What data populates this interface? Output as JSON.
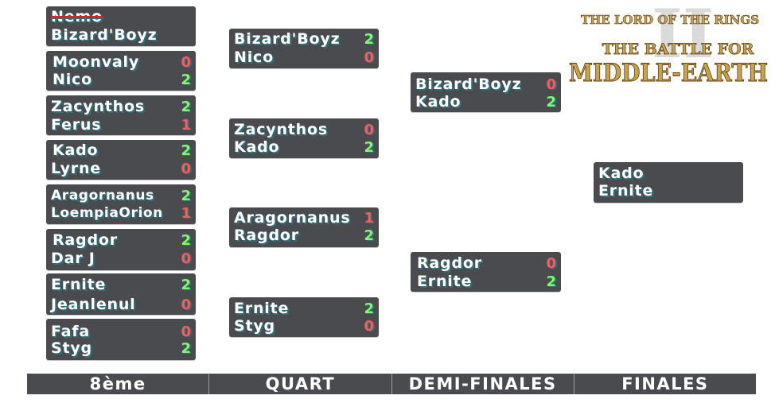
{
  "rounds": {
    "r16": [
      {
        "p1": {
          "name": "Nemo",
          "score": ""
        },
        "p2": {
          "name": "Bizard'Boyz",
          "score": ""
        }
      },
      {
        "p1": {
          "name": "Moonvaly",
          "score": "0"
        },
        "p2": {
          "name": "Nico",
          "score": "2"
        }
      },
      {
        "p1": {
          "name": "Zacynthos",
          "score": "2"
        },
        "p2": {
          "name": "Ferus",
          "score": "1"
        }
      },
      {
        "p1": {
          "name": "Kado",
          "score": "2"
        },
        "p2": {
          "name": "Lyrne",
          "score": "0"
        }
      },
      {
        "p1": {
          "name": "Aragornanus",
          "score": "2"
        },
        "p2": {
          "name": "LoempiaOrion",
          "score": "1"
        }
      },
      {
        "p1": {
          "name": "Ragdor",
          "score": "2"
        },
        "p2": {
          "name": "Dar J",
          "score": "0"
        }
      },
      {
        "p1": {
          "name": "Ernite",
          "score": "2"
        },
        "p2": {
          "name": "Jeanlenul",
          "score": "0"
        }
      },
      {
        "p1": {
          "name": "Fafa",
          "score": "0"
        },
        "p2": {
          "name": "Styg",
          "score": "2"
        }
      }
    ],
    "qf": [
      {
        "p1": {
          "name": "Bizard'Boyz",
          "score": "2"
        },
        "p2": {
          "name": "Nico",
          "score": "0"
        }
      },
      {
        "p1": {
          "name": "Zacynthos",
          "score": "0"
        },
        "p2": {
          "name": "Kado",
          "score": "2"
        }
      },
      {
        "p1": {
          "name": "Aragornanus",
          "score": "1"
        },
        "p2": {
          "name": "Ragdor",
          "score": "2"
        }
      },
      {
        "p1": {
          "name": "Ernite",
          "score": "2"
        },
        "p2": {
          "name": "Styg",
          "score": "0"
        }
      }
    ],
    "sf": [
      {
        "p1": {
          "name": "Bizard'Boyz",
          "score": "0"
        },
        "p2": {
          "name": "Kado",
          "score": "2"
        }
      },
      {
        "p1": {
          "name": "Ragdor",
          "score": "0"
        },
        "p2": {
          "name": "Ernite",
          "score": "2"
        }
      }
    ],
    "final": [
      {
        "p1": {
          "name": "Kado",
          "score": ""
        },
        "p2": {
          "name": "Ernite",
          "score": ""
        }
      }
    ]
  },
  "footer": {
    "labels": [
      "8ème",
      "QUART",
      "DEMI-FINALES",
      "FINALES"
    ]
  },
  "logo": {
    "line1": "THE LORD OF THE RINGS",
    "line2": "THE BATTLE FOR",
    "line3": "MIDDLE-EARTH",
    "numeral": "II"
  },
  "colors": {
    "box": "#4a4b4f",
    "win": "#7dff6a",
    "lose": "#ff5a5a",
    "logo_gold": "#c9a24a"
  }
}
